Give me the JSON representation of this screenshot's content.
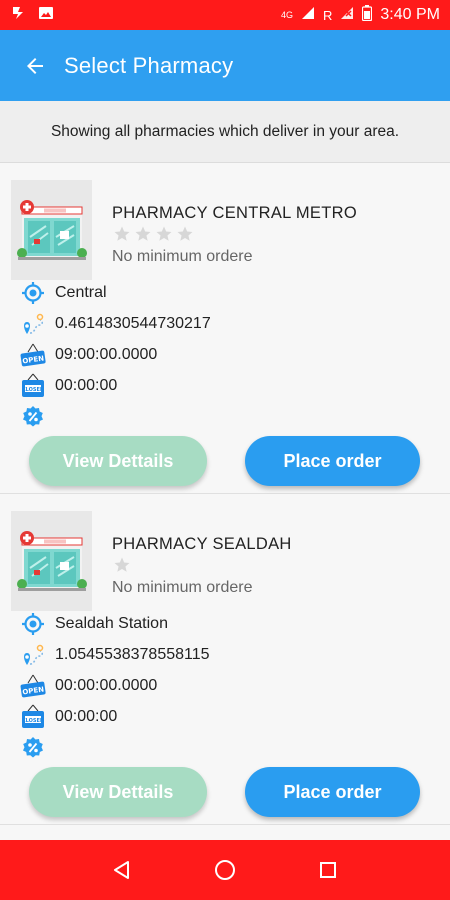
{
  "status_bar": {
    "time": "3:40 PM",
    "network": "4G",
    "roaming": "R",
    "colors": {
      "background": "#ff1a1a"
    }
  },
  "app_bar": {
    "title": "Select Pharmacy",
    "back_icon": "arrow-left-icon",
    "color": "#2f9ff0"
  },
  "info_banner": {
    "text": "Showing all pharmacies which deliver in your area."
  },
  "pharmacies": [
    {
      "name": "PHARMACY CENTRAL METRO",
      "rating": 0,
      "stars_shown": 4,
      "min_order": "No minimum ordere",
      "location": "Central",
      "distance": "0.4614830544730217",
      "open_time": "09:00:00.0000",
      "close_time": "00:00:00",
      "view_label": "View Dettails",
      "order_label": "Place order"
    },
    {
      "name": "PHARMACY SEALDAH",
      "rating": 0,
      "stars_shown": 1,
      "min_order": "No minimum ordere",
      "location": "Sealdah Station",
      "distance": "1.0545538378558115",
      "open_time": "00:00:00.0000",
      "close_time": "00:00:00",
      "view_label": "View Dettails",
      "order_label": "Place order"
    }
  ],
  "icons": {
    "location": "target-location-icon",
    "distance": "distance-pin-icon",
    "open": "open-sign-icon",
    "closed": "closed-sign-icon",
    "discount": "discount-badge-icon"
  },
  "colors": {
    "primary": "#2a9df0",
    "view_button": "#a7dcc3",
    "accent_icon": "#2a9df0"
  },
  "nav_bar": {
    "buttons": [
      "back-triangle-icon",
      "home-circle-icon",
      "recents-square-icon"
    ]
  }
}
